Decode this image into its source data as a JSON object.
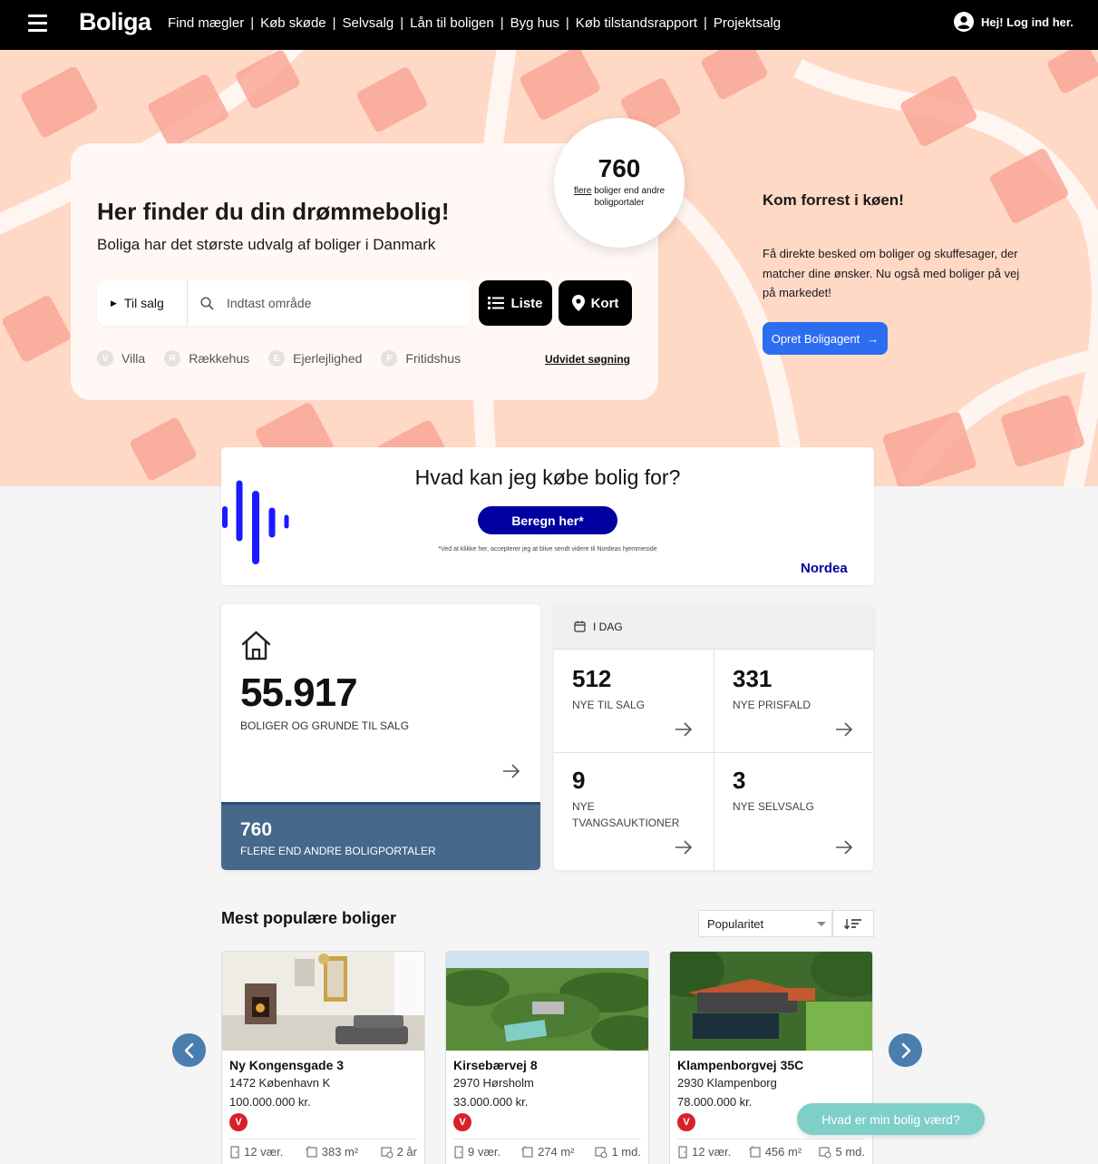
{
  "header": {
    "logo": "Boliga",
    "nav": [
      "Find mægler",
      "Køb skøde",
      "Selvsalg",
      "Lån til boligen",
      "Byg hus",
      "Køb tilstandsrapport",
      "Projektsalg"
    ],
    "separator": "|",
    "login": "Hej! Log ind her."
  },
  "hero": {
    "title": "Her finder du din drømmebolig!",
    "subtitle": "Boliga har det største udvalg af boliger i Danmark",
    "badge": {
      "number": "760",
      "link": "flere",
      "text": "boliger end andre boligportaler"
    },
    "search": {
      "sale_type": "Til salg",
      "placeholder": "Indtast område",
      "list_button": "Liste",
      "map_button": "Kort"
    },
    "property_types": [
      {
        "letter": "V",
        "label": "Villa"
      },
      {
        "letter": "R",
        "label": "Rækkehus"
      },
      {
        "letter": "E",
        "label": "Ejerlejlighed"
      },
      {
        "letter": "F",
        "label": "Fritidshus"
      }
    ],
    "advanced": "Udvidet søgning",
    "promo": {
      "title": "Kom forrest i køen!",
      "text": "Få direkte besked om boliger og skuffesager, der matcher dine ønsker. Nu også med boliger på vej på markedet!",
      "button": "Opret Boligagent"
    }
  },
  "ad": {
    "title": "Hvad kan jeg købe bolig for?",
    "button": "Beregn her*",
    "note": "*Ved at klikke her, accepterer jeg at blive sendt videre til Nordeas hjemmeside",
    "brand": "Nordea",
    "brand_color": "#0000a0"
  },
  "stats": {
    "total": {
      "number": "55.917",
      "label": "BOLIGER OG GRUNDE TIL SALG"
    },
    "more": {
      "number": "760",
      "label": "FLERE END ANDRE BOLIGPORTALER"
    },
    "today": {
      "header": "I DAG",
      "cells": [
        {
          "number": "512",
          "label": "NYE TIL SALG"
        },
        {
          "number": "331",
          "label": "NYE PRISFALD"
        },
        {
          "number": "9",
          "label": "NYE TVANGSAUKTIONER"
        },
        {
          "number": "3",
          "label": "NYE SELVSALG"
        }
      ]
    }
  },
  "popular": {
    "title": "Mest populære boliger",
    "sort": "Popularitet",
    "cards": [
      {
        "address": "Ny Kongensgade 3",
        "city": "1472 København K",
        "price": "100.000.000 kr.",
        "type": "V",
        "rooms": "12 vær.",
        "size": "383 m²",
        "age": "2 år"
      },
      {
        "address": "Kirsebærvej 8",
        "city": "2970 Hørsholm",
        "price": "33.000.000 kr.",
        "type": "V",
        "rooms": "9 vær.",
        "size": "274 m²",
        "age": "1 md."
      },
      {
        "address": "Klampenborgvej 35C",
        "city": "2930 Klampenborg",
        "price": "78.000.000 kr.",
        "type": "V",
        "rooms": "12 vær.",
        "size": "456 m²",
        "age": "5 md."
      }
    ]
  },
  "valuation_button": "Hvad er min bolig værd?",
  "colors": {
    "hero_bg": "#ffd8c6",
    "accent_blue": "#2d6ef0",
    "stat_footer": "#45688b",
    "badge_red": "#d8202a",
    "teal": "#7ecfc8"
  }
}
